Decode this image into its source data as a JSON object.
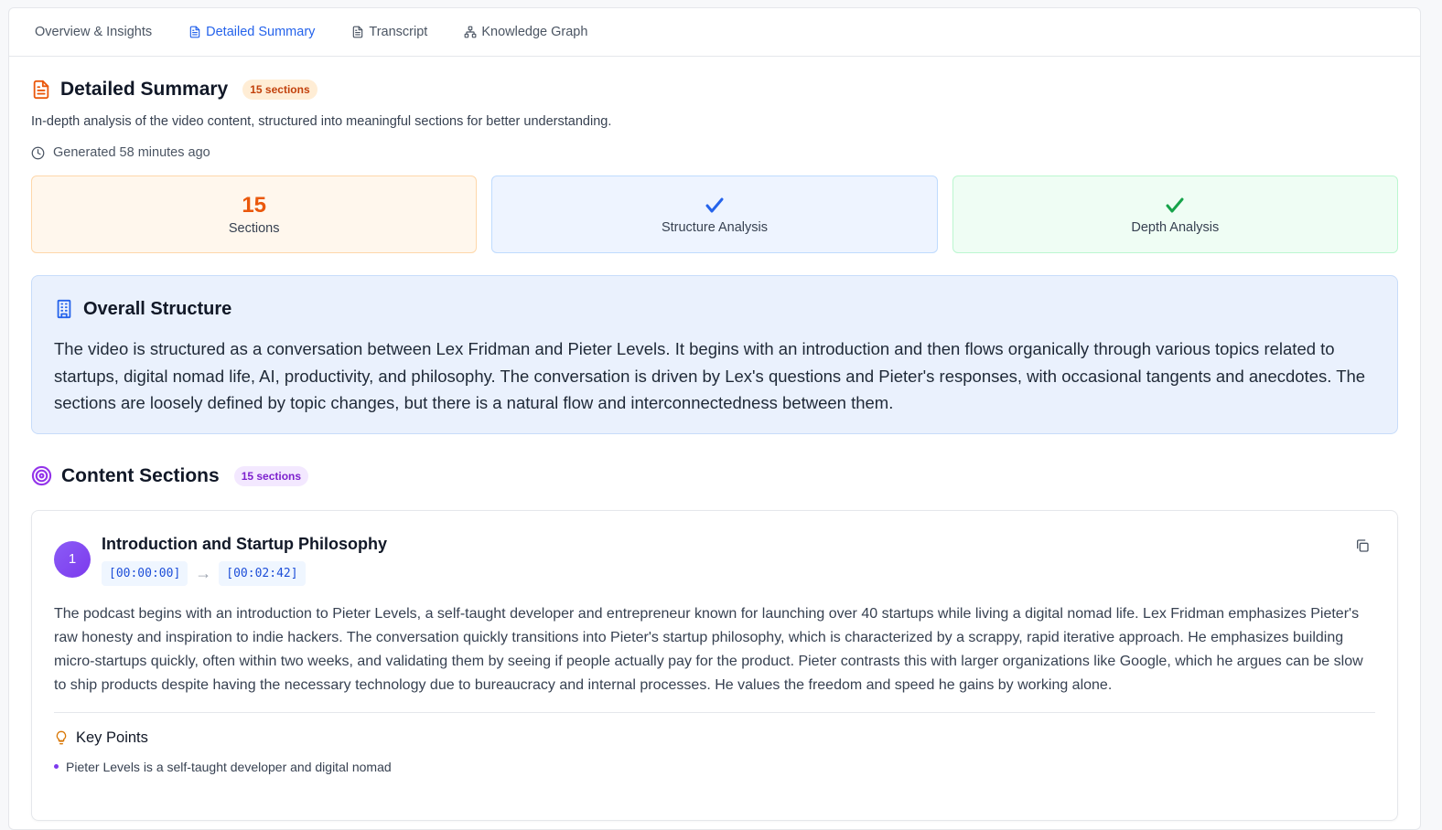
{
  "tabs": [
    {
      "label": "Overview & Insights",
      "icon": "none"
    },
    {
      "label": "Detailed Summary",
      "icon": "document-icon"
    },
    {
      "label": "Transcript",
      "icon": "document-icon"
    },
    {
      "label": "Knowledge Graph",
      "icon": "network-icon"
    }
  ],
  "header": {
    "title": "Detailed Summary",
    "badge": "15 sections",
    "description": "In-depth analysis of the video content, structured into meaningful sections for better understanding.",
    "generated": "Generated 58 minutes ago"
  },
  "stats": [
    {
      "value": "15",
      "label": "Sections"
    },
    {
      "value": "✓",
      "label": "Structure Analysis"
    },
    {
      "value": "✓",
      "label": "Depth Analysis"
    }
  ],
  "overall": {
    "title": "Overall Structure",
    "text": "The video is structured as a conversation between Lex Fridman and Pieter Levels. It begins with an introduction and then flows organically through various topics related to startups, digital nomad life, AI, productivity, and philosophy. The conversation is driven by Lex's questions and Pieter's responses, with occasional tangents and anecdotes. The sections are loosely defined by topic changes, but there is a natural flow and interconnectedness between them."
  },
  "sections_header": {
    "title": "Content Sections",
    "badge": "15 sections"
  },
  "section1": {
    "number": "1",
    "title": "Introduction and Startup Philosophy",
    "start": "[00:00:00]",
    "arrow": "→",
    "end": "[00:02:42]",
    "body": "The podcast begins with an introduction to Pieter Levels, a self-taught developer and entrepreneur known for launching over 40 startups while living a digital nomad life. Lex Fridman emphasizes Pieter's raw honesty and inspiration to indie hackers. The conversation quickly transitions into Pieter's startup philosophy, which is characterized by a scrappy, rapid iterative approach. He emphasizes building micro-startups quickly, often within two weeks, and validating them by seeing if people actually pay for the product. Pieter contrasts this with larger organizations like Google, which he argues can be slow to ship products despite having the necessary technology due to bureaucracy and internal processes. He values the freedom and speed he gains by working alone.",
    "key_points_label": "Key Points",
    "key_points": [
      "Pieter Levels is a self-taught developer and digital nomad"
    ]
  },
  "colors": {
    "accent_blue": "#2563eb",
    "orange": "#ea580c",
    "green": "#16a34a",
    "purple": "#7c3aed"
  }
}
